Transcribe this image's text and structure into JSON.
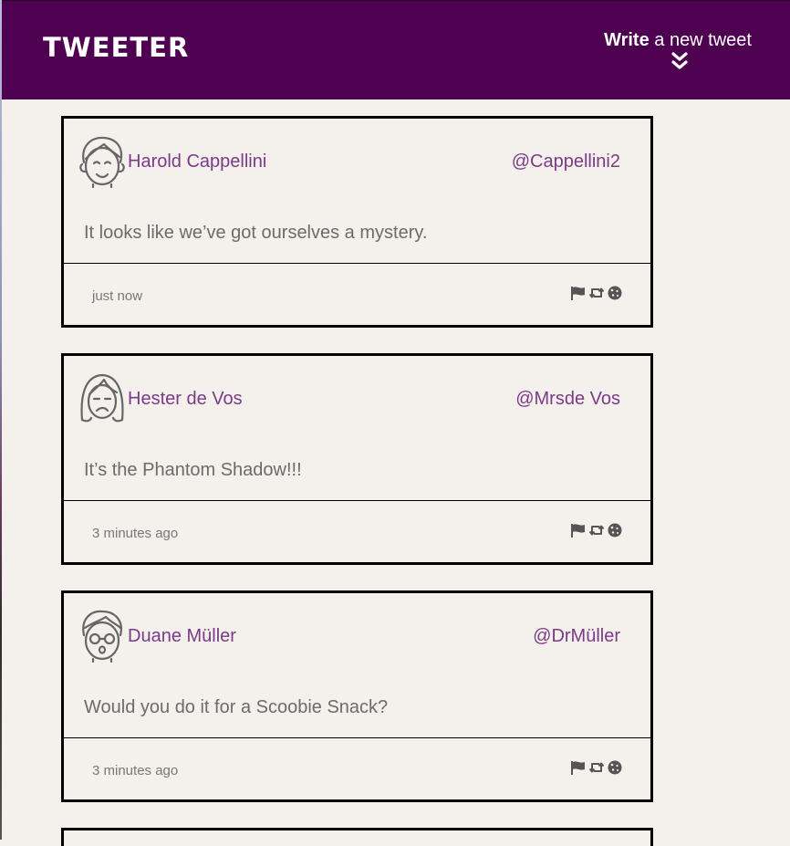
{
  "app": {
    "brand": "TWEETER"
  },
  "header": {
    "compose_bold": "Write",
    "compose_rest": " a new tweet"
  },
  "tweets": [
    {
      "name": "Harold Cappellini",
      "handle": "@Cappellini2",
      "content": "It looks like we’ve got ourselves a mystery.",
      "time": "just now",
      "avatar": "smiling-man-icon"
    },
    {
      "name": "Hester de Vos",
      "handle": "@Mrsde Vos",
      "content": "It’s the Phantom Shadow!!!",
      "time": "3 minutes ago",
      "avatar": "frowning-woman-icon"
    },
    {
      "name": "Duane Müller",
      "handle": "@DrMüller",
      "content": "Would you do it for a Scoobie Snack?",
      "time": "3 minutes ago",
      "avatar": "glasses-man-icon"
    }
  ],
  "colors": {
    "nav": "#4e0051",
    "link": "#7b3a88",
    "background": "#f4f1ec"
  },
  "icons": {
    "actions": [
      "flag-icon",
      "retweet-icon",
      "cookie-icon"
    ],
    "compose": "double-chevron-down-icon"
  }
}
